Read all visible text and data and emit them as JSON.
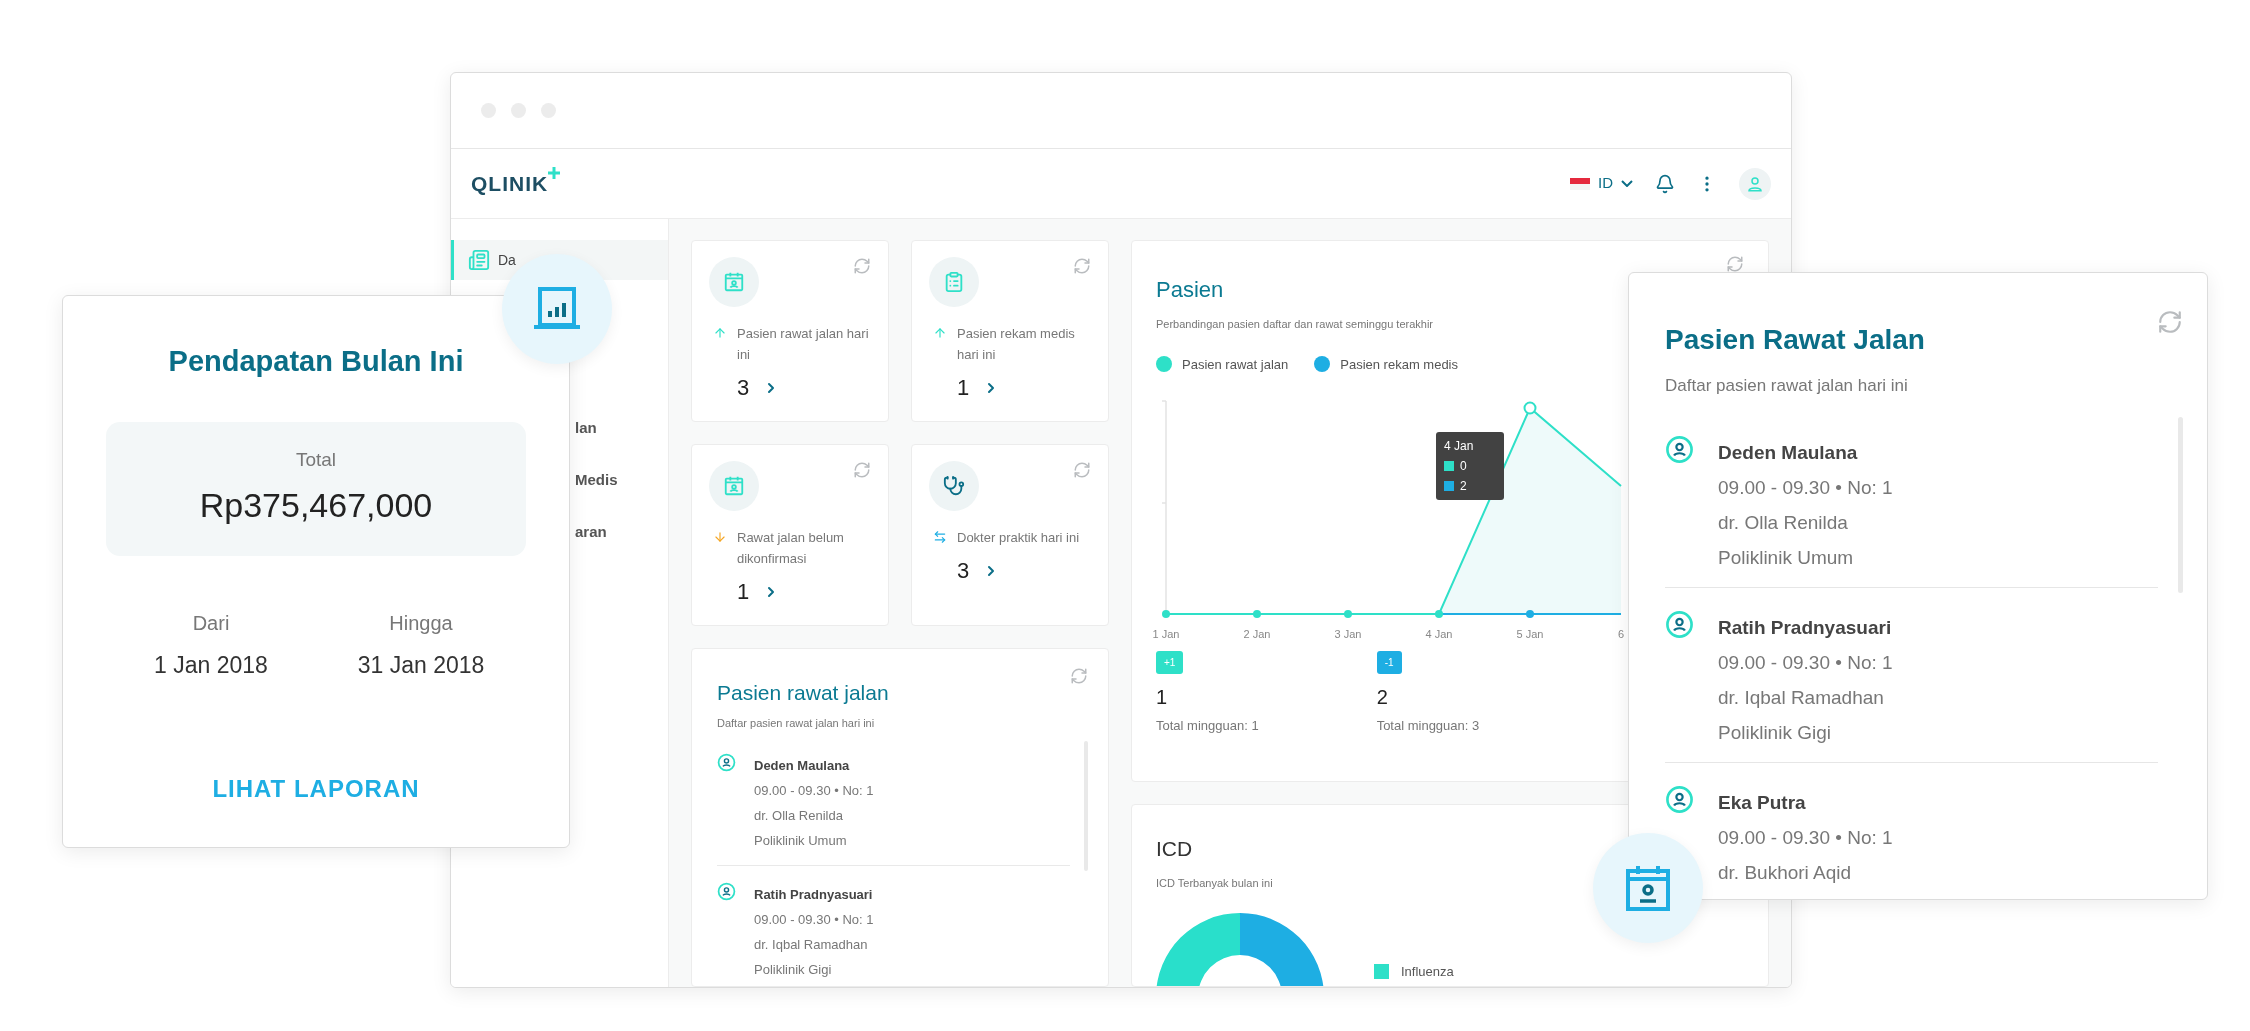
{
  "header": {
    "logo": "QLINIK",
    "language": "ID"
  },
  "sidebar": {
    "items": [
      {
        "label": "Da",
        "selected": true
      },
      {
        "label": "lan",
        "selected": false
      },
      {
        "label": "Medis",
        "selected": false
      },
      {
        "label": "aran",
        "selected": false
      }
    ]
  },
  "stat_cards": [
    {
      "kind": "outpatients",
      "title": "Pasien rawat jalan hari ini",
      "value": "3"
    },
    {
      "kind": "records",
      "title": "Pasien rekam medis hari ini",
      "value": "1"
    },
    {
      "kind": "unconfirmed",
      "title": "Rawat jalan belum dikonfirmasi",
      "value": "1"
    },
    {
      "kind": "doctors",
      "title": "Dokter praktik hari ini",
      "value": "3"
    }
  ],
  "outpatient_card": {
    "title": "Pasien rawat jalan",
    "subtitle": "Daftar pasien rawat jalan hari ini",
    "patients": [
      {
        "name": "Deden Maulana",
        "time": "09.00 - 09.30 • No: 1",
        "doctor": "dr. Olla Renilda",
        "clinic": "Poliklinik Umum"
      },
      {
        "name": "Ratih Pradnyasuari",
        "time": "09.00 - 09.30 • No: 1",
        "doctor": "dr. Iqbal Ramadhan",
        "clinic": "Poliklinik Gigi"
      }
    ]
  },
  "patients_chart": {
    "title": "Pasien",
    "subtitle": "Perbandingan pasien daftar dan rawat seminggu terakhir",
    "legend": [
      {
        "label": "Pasien rawat jalan",
        "color": "#2ee0c8"
      },
      {
        "label": "Pasien rekam medis",
        "color": "#1eaee3"
      }
    ],
    "x_labels": [
      "1 Jan",
      "2 Jan",
      "3 Jan",
      "4 Jan",
      "5 Jan",
      "6"
    ],
    "tooltip": {
      "title": "4 Jan",
      "rows": [
        {
          "value": "0",
          "color": "#2ee0c8"
        },
        {
          "value": "2",
          "color": "#1eaee3"
        }
      ]
    },
    "totals": [
      {
        "badge": "+1",
        "value": "1",
        "caption": "Total mingguan: 1",
        "color": "#2ee0c8"
      },
      {
        "badge": "-1",
        "value": "2",
        "caption": "Total mingguan: 3",
        "color": "#1eaee3"
      }
    ]
  },
  "icd_card": {
    "title": "ICD",
    "subtitle": "ICD Terbanyak bulan ini",
    "legend": [
      {
        "label": "Influenza",
        "color": "#2ee0c8"
      }
    ]
  },
  "revenue_card": {
    "title": "Pendapatan Bulan Ini",
    "total_label": "Total",
    "total": "Rp375,467,000",
    "from_label": "Dari",
    "from": "1 Jan 2018",
    "to_label": "Hingga",
    "to": "31 Jan 2018",
    "link": "LIHAT LAPORAN"
  },
  "outpatient_panel": {
    "title": "Pasien Rawat Jalan",
    "subtitle": "Daftar pasien rawat jalan hari ini",
    "patients": [
      {
        "name": "Deden Maulana",
        "time": "09.00 - 09.30 • No: 1",
        "doctor": "dr. Olla Renilda",
        "clinic": "Poliklinik Umum"
      },
      {
        "name": "Ratih Pradnyasuari",
        "time": "09.00 - 09.30 • No: 1",
        "doctor": "dr. Iqbal Ramadhan",
        "clinic": "Poliklinik Gigi"
      },
      {
        "name": "Eka Putra",
        "time": "09.00 - 09.30 • No: 1",
        "doctor": "dr. Bukhori Aqid"
      }
    ]
  }
}
